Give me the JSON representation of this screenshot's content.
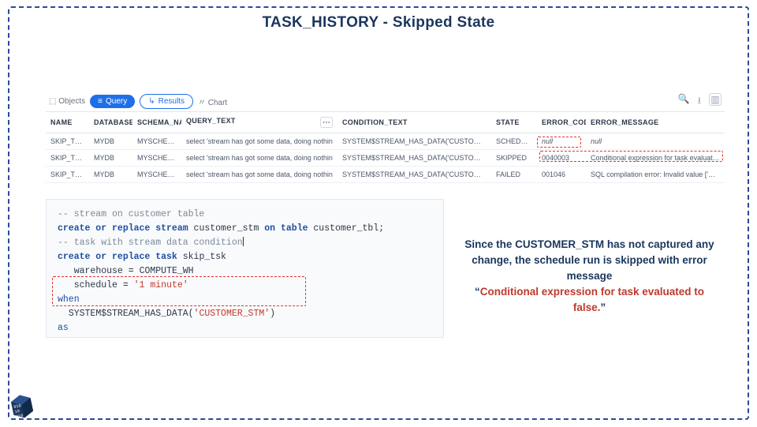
{
  "title": "TASK_HISTORY - Skipped State",
  "toolbar": {
    "objects": "Objects",
    "query": "Query",
    "results": "Results",
    "chart": "Chart",
    "search_icon": "search",
    "download_icon": "download",
    "columns_icon": "columns"
  },
  "columns": {
    "name": "NAME",
    "database": "DATABASE_",
    "schema": "SCHEMA_NA",
    "query_text": "QUERY_TEXT",
    "condition_text": "CONDITION_TEXT",
    "state": "STATE",
    "error_code": "ERROR_CODE",
    "error_message": "ERROR_MESSAGE"
  },
  "rows": [
    {
      "name": "SKIP_TSK",
      "db": "MYDB",
      "schema": "MYSCHEMA",
      "qt": "select 'stream has got some data, doing nothin",
      "ct": "SYSTEM$STREAM_HAS_DATA('CUSTOMER_STM')",
      "state": "SCHEDULED",
      "ec": "",
      "em": ""
    },
    {
      "name": "SKIP_TSK",
      "db": "MYDB",
      "schema": "MYSCHEMA",
      "qt": "select 'stream has got some data, doing nothin",
      "ct": "SYSTEM$STREAM_HAS_DATA('CUSTOMER_STM')",
      "state": "SKIPPED",
      "ec": "0040003",
      "em": "Conditional expression for task evaluated to false."
    },
    {
      "name": "SKIP_TSK",
      "db": "MYDB",
      "schema": "MYSCHEMA",
      "qt": "select 'stream has got some data, doing nothin",
      "ct": "SYSTEM$STREAM_HAS_DATA('CUSTOMER_TBL')",
      "state": "FAILED",
      "ec": "001046",
      "em": "SQL compilation error: Invalid value ['CUSTOMER_T"
    }
  ],
  "code": {
    "l1": "-- stream on customer table",
    "l2a": "create or replace stream",
    "l2b": "customer_stm",
    "l2c": "on table",
    "l2d": "customer_tbl;",
    "l3": "-- task with stream data condition",
    "l4a": "create or replace task",
    "l4b": "skip_tsk",
    "l5a": "warehouse",
    "l5b": "=",
    "l5c": "COMPUTE_WH",
    "l6a": "schedule",
    "l6b": "=",
    "l6c": "'1 minute'",
    "l7": "when",
    "l8a": "SYSTEM$STREAM_HAS_DATA(",
    "l8b": "'CUSTOMER_STM'",
    "l8c": ")",
    "l9": "as",
    "l10a": "select",
    "l10b": "'stream has got some data, doing nothing'",
    "l10c": ";"
  },
  "explain": {
    "p1": "Since the CUSTOMER_STM has not captured any change, the schedule run is skipped with error message",
    "p2": "“",
    "p3": "Conditional expression for task evaluated to false.",
    "p4": "”"
  },
  "null_text": "null"
}
